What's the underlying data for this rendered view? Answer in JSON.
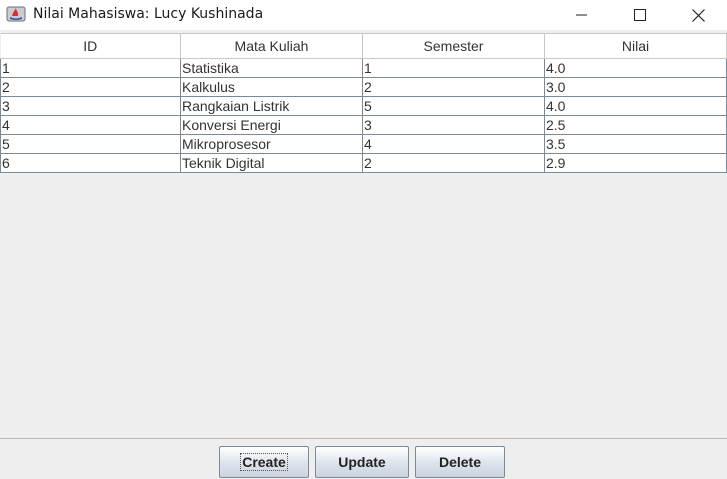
{
  "window": {
    "title": "Nilai Mahasiswa: Lucy Kushinada"
  },
  "table": {
    "columns": [
      "ID",
      "Mata Kuliah",
      "Semester",
      "Nilai"
    ],
    "rows": [
      [
        "1",
        "Statistika",
        "1",
        "4.0"
      ],
      [
        "2",
        "Kalkulus",
        "2",
        "3.0"
      ],
      [
        "3",
        "Rangkaian Listrik",
        "5",
        "4.0"
      ],
      [
        "4",
        "Konversi Energi",
        "3",
        "2.5"
      ],
      [
        "5",
        "Mikroprosesor",
        "4",
        "3.5"
      ],
      [
        "6",
        "Teknik Digital",
        "2",
        "2.9"
      ]
    ]
  },
  "buttons": {
    "create": "Create",
    "update": "Update",
    "delete": "Delete"
  },
  "icons": {
    "app": "java-app-icon",
    "minimize": "minimize-icon",
    "maximize": "maximize-icon",
    "close": "close-icon"
  }
}
